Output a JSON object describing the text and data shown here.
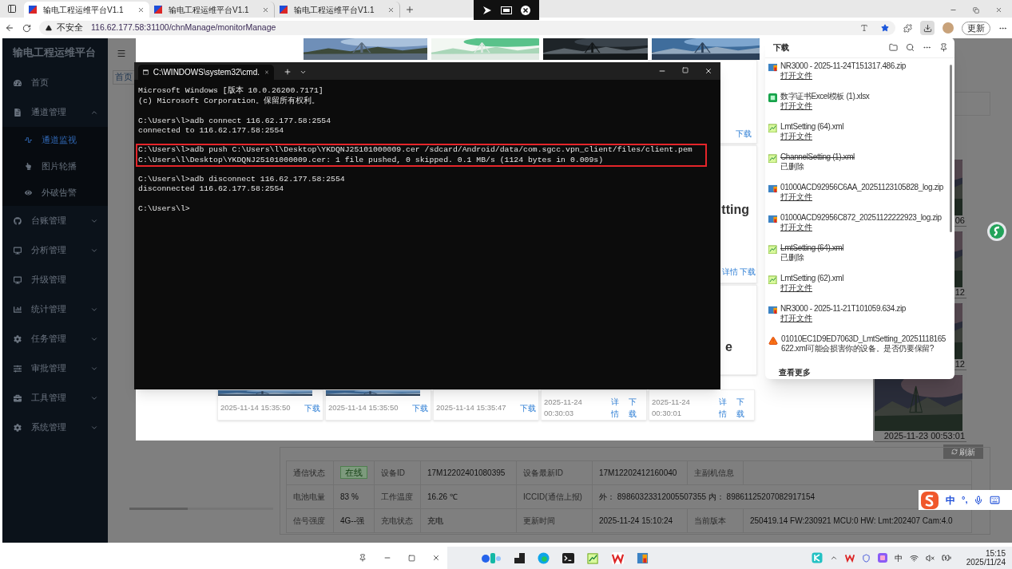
{
  "browser": {
    "tabs": [
      {
        "title": "输电工程运维平台V1.1",
        "selected": true
      },
      {
        "title": "输电工程运维平台V1.1",
        "selected": false
      },
      {
        "title": "输电工程运维平台V1.1",
        "selected": false
      }
    ],
    "security_label": "不安全",
    "url": "116.62.177.58:31100/chnManage/monitorManage",
    "update_button": "更新"
  },
  "sidebar": {
    "title": "输电工程运维平台",
    "items": [
      {
        "label": "首页",
        "kind": "link"
      },
      {
        "label": "通道管理",
        "kind": "menu",
        "expanded": true,
        "children": [
          {
            "label": "通道监视",
            "selected": true
          },
          {
            "label": "图片轮播",
            "selected": false
          },
          {
            "label": "外破告警",
            "selected": false
          }
        ]
      },
      {
        "label": "台账管理",
        "kind": "menu",
        "expanded": false
      },
      {
        "label": "分析管理",
        "kind": "menu",
        "expanded": false
      },
      {
        "label": "升级管理",
        "kind": "link"
      },
      {
        "label": "统计管理",
        "kind": "menu",
        "expanded": false
      },
      {
        "label": "任务管理",
        "kind": "menu",
        "expanded": false
      },
      {
        "label": "审批管理",
        "kind": "menu",
        "expanded": false
      },
      {
        "label": "工具管理",
        "kind": "menu",
        "expanded": false
      },
      {
        "label": "系统管理",
        "kind": "menu",
        "expanded": false
      }
    ]
  },
  "page": {
    "tab": "首页",
    "photo_captions": [
      "06",
      "12",
      "12",
      "2025-11-23 00:53:01"
    ],
    "refresh_button": "刷新",
    "info_table": [
      [
        {
          "kind": "label",
          "text": "通信状态"
        },
        {
          "kind": "badge",
          "text": "在线"
        },
        {
          "kind": "label",
          "text": "设备ID"
        },
        {
          "kind": "value",
          "text": "17M12202401080395"
        },
        {
          "kind": "label",
          "text": "设备最新ID"
        },
        {
          "kind": "value",
          "text": "17M12202412160040"
        },
        {
          "kind": "label",
          "text": "主副机信息"
        }
      ],
      [
        {
          "kind": "label",
          "text": "电池电量"
        },
        {
          "kind": "value",
          "text": "83 %"
        },
        {
          "kind": "label",
          "text": "工作温度"
        },
        {
          "kind": "value",
          "text": "16.26 ℃"
        },
        {
          "kind": "label",
          "text": "ICCID(通信上报)"
        },
        {
          "kind": "wide",
          "text": "外：  89860323312005507355  内：  89861125207082917154"
        }
      ],
      [
        {
          "kind": "label",
          "text": "信号强度"
        },
        {
          "kind": "value",
          "text": "4G--强"
        },
        {
          "kind": "label",
          "text": "充电状态"
        },
        {
          "kind": "value",
          "text": "充电"
        },
        {
          "kind": "label",
          "text": "更新时间"
        },
        {
          "kind": "value",
          "text": "2025-11-24 15:10:24"
        },
        {
          "kind": "label",
          "text": "当前版本"
        },
        {
          "kind": "value",
          "text": "250419.14 FW:230921 MCU:0 HW: Lmt:202407 Cam:4.0"
        }
      ]
    ]
  },
  "modal": {
    "top_card_action": "下载",
    "middle_card": {
      "title": "tting",
      "actions": [
        "详情",
        "下载"
      ]
    },
    "lower_card_title": "e",
    "bottom_cards": [
      {
        "time": "2025-11-14 15:35:50",
        "actions": [
          "下载"
        ]
      },
      {
        "time": "2025-11-14 15:35:50",
        "actions": [
          "下载"
        ]
      },
      {
        "time": "2025-11-14 15:35:47",
        "actions": [
          "下载"
        ]
      },
      {
        "time": "2025-11-24 00:30:03",
        "actions": [
          "详情",
          "下载"
        ]
      },
      {
        "time": "2025-11-24 00:30:01",
        "actions": [
          "详情",
          "下载"
        ]
      }
    ]
  },
  "terminal": {
    "title": "C:\\WINDOWS\\system32\\cmd.",
    "blocks": [
      {
        "highlighted": false,
        "lines": [
          "Microsoft Windows [版本 10.0.26200.7171]",
          "(c) Microsoft Corporation。保留所有权利。"
        ]
      },
      {
        "highlighted": false,
        "lines": [
          "C:\\Users\\l>adb connect 116.62.177.58:2554",
          "connected to 116.62.177.58:2554"
        ]
      },
      {
        "highlighted": true,
        "lines": [
          "C:\\Users\\l>adb push C:\\Users\\l\\Desktop\\YKDQNJ25101000009.cer /sdcard/Android/data/com.sgcc.vpn_client/files/client.pem",
          "C:\\Users\\l\\Desktop\\YKDQNJ25101000009.cer: 1 file pushed, 0 skipped. 0.1 MB/s (1124 bytes in 0.009s)"
        ]
      },
      {
        "highlighted": false,
        "lines": [
          "C:\\Users\\l>adb disconnect 116.62.177.58:2554",
          "disconnected 116.62.177.58:2554"
        ]
      },
      {
        "highlighted": false,
        "lines": [
          "C:\\Users\\l>"
        ]
      }
    ]
  },
  "downloads": {
    "title": "下载",
    "items": [
      {
        "kind": "zip",
        "name": "NR3000 - 2025-11-24T151317.486.zip",
        "status": "打开文件",
        "deleted": false
      },
      {
        "kind": "xlsx",
        "name": "数字证书Excel模板 (1).xlsx",
        "status": "打开文件",
        "deleted": false
      },
      {
        "kind": "xml",
        "name": "LmtSetting (64).xml",
        "status": "打开文件",
        "deleted": false
      },
      {
        "kind": "xml",
        "name": "ChannelSetting (1).xml",
        "status": "已删除",
        "deleted": true
      },
      {
        "kind": "zip",
        "name": "01000ACD92956C6AA_20251123105828_log.zip",
        "status": "打开文件",
        "deleted": false
      },
      {
        "kind": "zip",
        "name": "01000ACD92956C872_20251122222923_log.zip",
        "status": "打开文件",
        "deleted": false
      },
      {
        "kind": "xml",
        "name": "LmtSetting (64).xml",
        "status": "已删除",
        "deleted": true
      },
      {
        "kind": "xml",
        "name": "LmtSetting (62).xml",
        "status": "打开文件",
        "deleted": false
      },
      {
        "kind": "zip",
        "name": "NR3000 - 2025-11-21T101059.634.zip",
        "status": "打开文件",
        "deleted": false
      },
      {
        "kind": "warning",
        "name": "01010EC1D9ED7063D_LmtSetting_20251118165622.xml可能会损害你的设备。是否仍要保留?",
        "deleted": false
      }
    ],
    "more": "查看更多"
  },
  "ime_bar": {
    "mode": "中",
    "punctuation": "°,"
  },
  "taskbar": {
    "tray_language": "中",
    "time": "15:15",
    "date": "2025/11/24"
  }
}
